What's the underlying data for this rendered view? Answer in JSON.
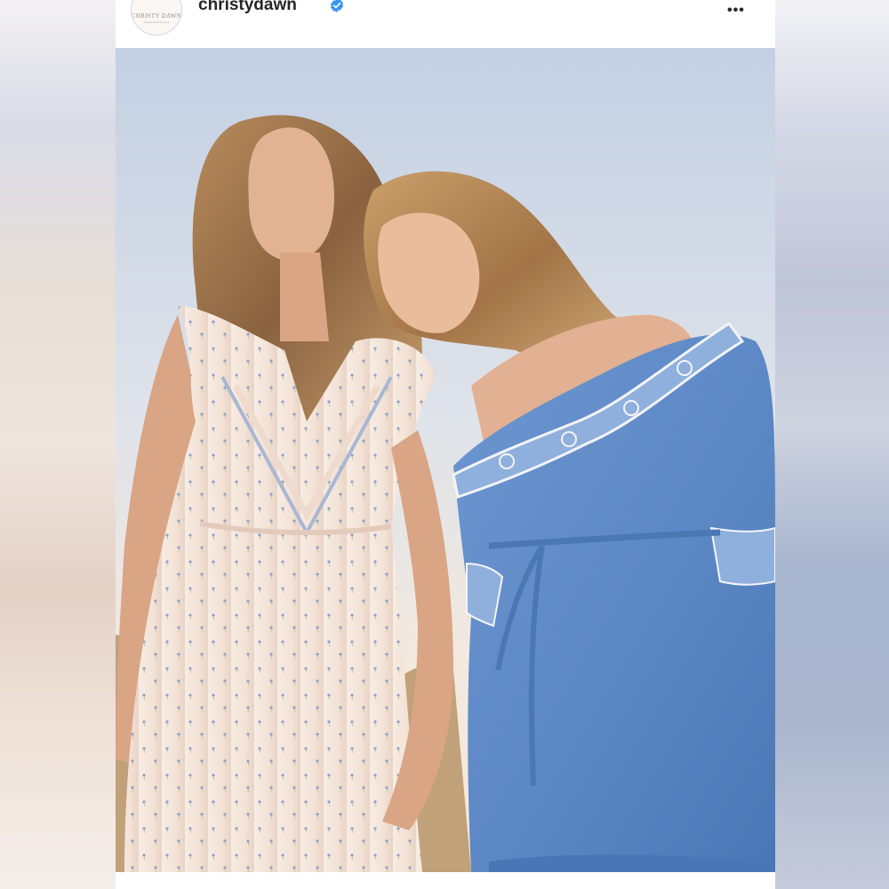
{
  "post": {
    "avatar_text": "CHRISTY DAWN",
    "avatar_subtext": "timeless heirloom goods",
    "username": "christydawn",
    "verified_icon": "verified-badge-icon",
    "more_icon": "more-options-icon",
    "more_label": "•••"
  },
  "photo": {
    "accent_sky": "#c7d3e4",
    "accent_blue_dress": "#5d88c7",
    "accent_cream_dress": "#f4e6da"
  }
}
